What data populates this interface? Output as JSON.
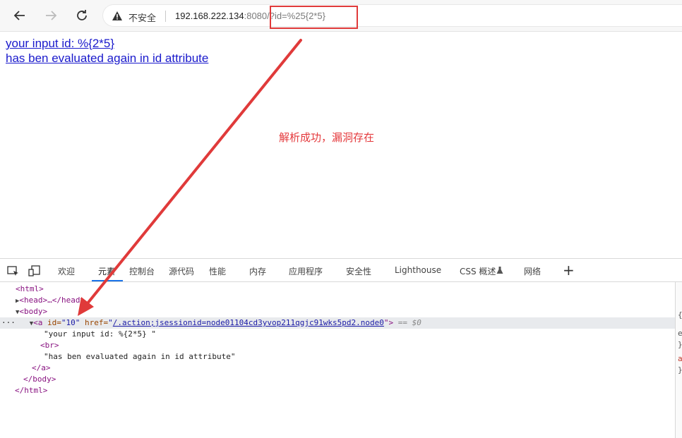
{
  "browser": {
    "back_icon": "arrow-left-icon",
    "forward_icon": "arrow-right-icon",
    "reload_icon": "reload-icon",
    "security_icon": "warning-triangle-icon",
    "security_label": "不安全",
    "url_host": "192.168.222.134",
    "url_port": ":8080/",
    "url_query": "?id=%25{2*5}"
  },
  "page": {
    "line1": "your input id: %{2*5}",
    "line2": "has ben evaluated again in id attribute"
  },
  "annotation": {
    "text": "解析成功，漏洞存在",
    "color": "#e4393c"
  },
  "devtools": {
    "tabs": [
      "欢迎",
      "元素",
      "控制台",
      "源代码",
      "性能",
      "内存",
      "应用程序",
      "安全性",
      "Lighthouse",
      "CSS 概述"
    ],
    "network_tab": "网络",
    "active_tab": "元素",
    "inspect_icon": "inspect-element-icon",
    "device_icon": "device-toolbar-icon",
    "flask_icon": "flask-icon",
    "add_icon": "plus-icon",
    "dom": {
      "html_open": "<html>",
      "head": "<head>…</head>",
      "body_open": "<body>",
      "a_tag_open": "<a",
      "a_id_attr": "id=",
      "a_id_val": "\"10\"",
      "a_href_attr": "href=",
      "a_href_quote": "\"",
      "a_href_val": "/.action;jsessionid=node01104cd3yvop211qgjc91wks5pd2.node0",
      "a_tag_close": "\">",
      "selected_marker": "== $0",
      "text1": "\"your input id: %{2*5} \"",
      "br": "<br>",
      "text2": "\"has ben evaluated again in id attribute\"",
      "a_close": "</a>",
      "body_close": "</body>",
      "html_close": "</html>",
      "ellipsis": "···"
    },
    "side_glyphs": [
      "{",
      "e",
      "}",
      "a",
      "}"
    ]
  }
}
